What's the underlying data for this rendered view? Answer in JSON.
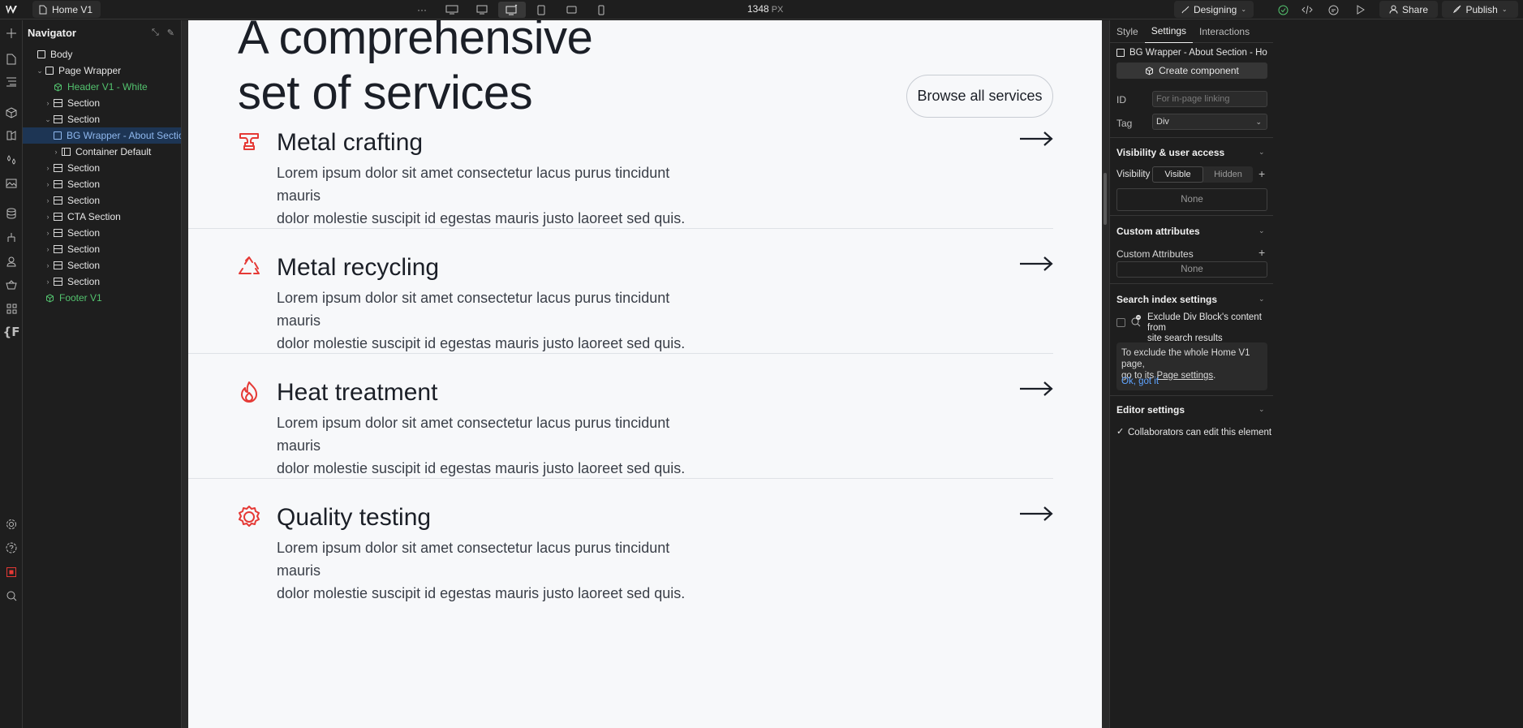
{
  "topbar": {
    "page_tab": "Home V1",
    "more": "···",
    "width_value": "1348",
    "width_unit": "PX",
    "mode": "Designing",
    "share": "Share",
    "publish": "Publish"
  },
  "navigator": {
    "title": "Navigator",
    "items": [
      {
        "label": "Body",
        "depth": 0,
        "type": "box",
        "caret": ""
      },
      {
        "label": "Page Wrapper",
        "depth": 1,
        "type": "box",
        "caret": "open"
      },
      {
        "label": "Header V1 - White",
        "depth": 2,
        "type": "component",
        "caret": ""
      },
      {
        "label": "Section",
        "depth": 2,
        "type": "section",
        "caret": "closed"
      },
      {
        "label": "Section",
        "depth": 2,
        "type": "section",
        "caret": "open"
      },
      {
        "label": "BG Wrapper - About Section - H",
        "depth": 3,
        "type": "box",
        "caret": "",
        "selected": true
      },
      {
        "label": "Container Default",
        "depth": 3,
        "type": "container",
        "caret": "closed"
      },
      {
        "label": "Section",
        "depth": 2,
        "type": "section",
        "caret": "closed"
      },
      {
        "label": "Section",
        "depth": 2,
        "type": "section",
        "caret": "closed"
      },
      {
        "label": "Section",
        "depth": 2,
        "type": "section",
        "caret": "closed"
      },
      {
        "label": "CTA Section",
        "depth": 2,
        "type": "section",
        "caret": "closed"
      },
      {
        "label": "Section",
        "depth": 2,
        "type": "section",
        "caret": "closed"
      },
      {
        "label": "Section",
        "depth": 2,
        "type": "section",
        "caret": "closed"
      },
      {
        "label": "Section",
        "depth": 2,
        "type": "section",
        "caret": "closed"
      },
      {
        "label": "Section",
        "depth": 2,
        "type": "section",
        "caret": "closed"
      },
      {
        "label": "Footer V1",
        "depth": 1,
        "type": "component",
        "caret": ""
      }
    ]
  },
  "canvas": {
    "hero_line1": "A comprehensive",
    "hero_line2": "set of services",
    "browse_button": "Browse all services",
    "services": [
      {
        "icon": "anvil-icon",
        "title": "Metal crafting",
        "line1": "Lorem ipsum dolor sit amet consectetur lacus purus tincidunt mauris",
        "line2": "dolor molestie suscipit id egestas mauris justo laoreet sed quis."
      },
      {
        "icon": "recycle-icon",
        "title": "Metal recycling",
        "line1": "Lorem ipsum dolor sit amet consectetur lacus purus tincidunt mauris",
        "line2": "dolor molestie suscipit id egestas mauris justo laoreet sed quis."
      },
      {
        "icon": "flame-icon",
        "title": "Heat treatment",
        "line1": "Lorem ipsum dolor sit amet consectetur lacus purus tincidunt mauris",
        "line2": "dolor molestie suscipit id egestas mauris justo laoreet sed quis."
      },
      {
        "icon": "badge-icon",
        "title": "Quality testing",
        "line1": "Lorem ipsum dolor sit amet consectetur lacus purus tincidunt mauris",
        "line2": "dolor molestie suscipit id egestas mauris justo laoreet sed quis."
      }
    ]
  },
  "panel": {
    "tabs": [
      "Style",
      "Settings",
      "Interactions"
    ],
    "active_tab": "Settings",
    "element_name": "BG Wrapper - About Section - Home V...",
    "create_component": "Create component",
    "id_label": "ID",
    "id_placeholder": "For in-page linking",
    "tag_label": "Tag",
    "tag_value": "Div",
    "visibility_title": "Visibility & user access",
    "visibility_label": "Visibility",
    "visible": "Visible",
    "hidden": "Hidden",
    "visibility_none": "None",
    "custom_title": "Custom attributes",
    "custom_label": "Custom Attributes",
    "custom_none": "None",
    "search_title": "Search index settings",
    "search_exclude_line1": "Exclude Div Block's content from",
    "search_exclude_line2": "site search results",
    "info_line1": "To exclude the whole Home V1 page,",
    "info_line2_pre": "go to its ",
    "info_link": "Page settings",
    "info_line2_post": ".",
    "info_ok": "Ok, got it",
    "editor_title": "Editor settings",
    "editor_collab": "Collaborators can edit this element"
  },
  "colors": {
    "accent_red": "#e53935",
    "selection_blue": "#1d3554",
    "component_green": "#53c26e",
    "link_blue": "#5ea3ff"
  }
}
